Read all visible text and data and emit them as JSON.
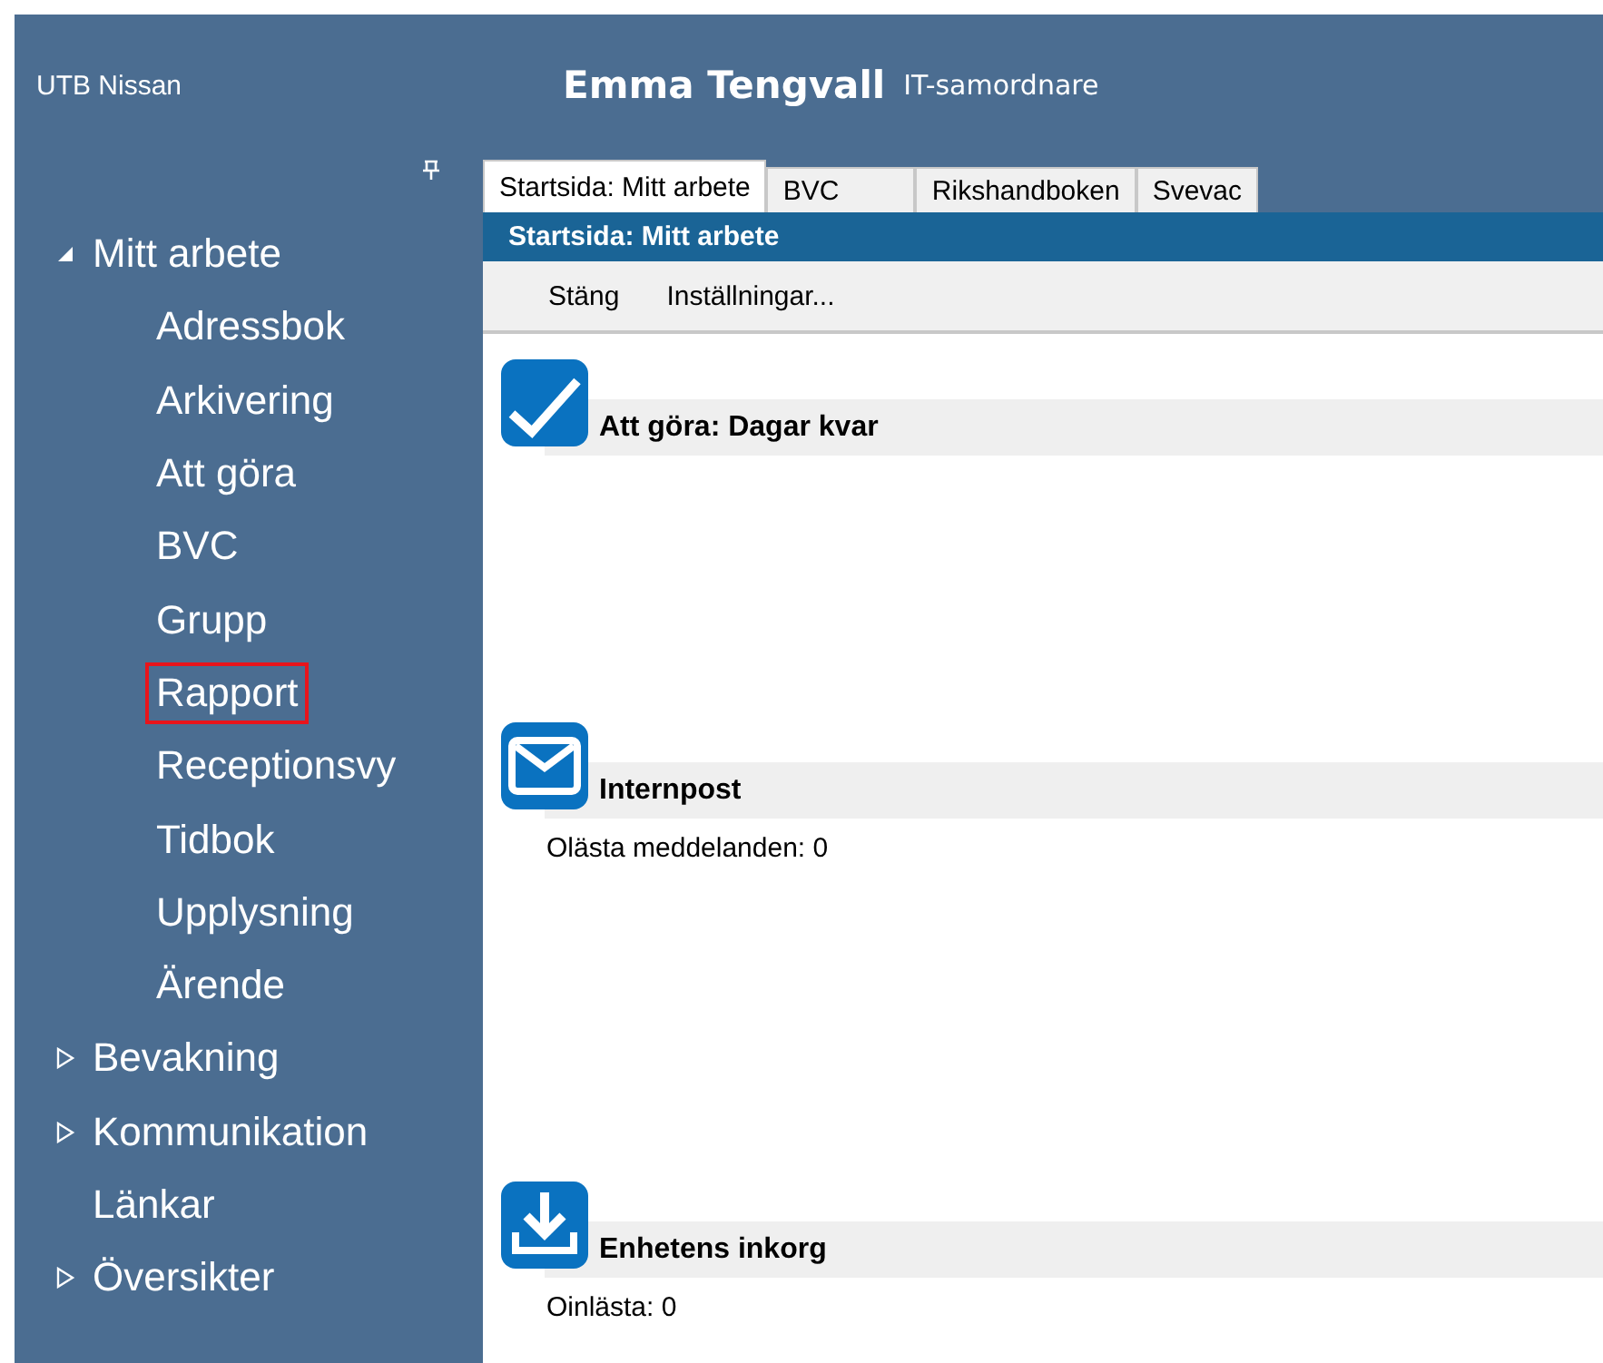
{
  "header": {
    "unit": "UTB Nissan",
    "user_name": "Emma Tengvall",
    "user_role": "IT-samordnare"
  },
  "sidebar": {
    "items": [
      {
        "label": "Mitt arbete",
        "expanded": true,
        "children": [
          {
            "label": "Adressbok",
            "marked": false
          },
          {
            "label": "Arkivering",
            "marked": false
          },
          {
            "label": "Att göra",
            "marked": false
          },
          {
            "label": "BVC",
            "marked": false
          },
          {
            "label": "Grupp",
            "marked": false
          },
          {
            "label": "Rapport",
            "marked": true
          },
          {
            "label": "Receptionsvy",
            "marked": false
          },
          {
            "label": "Tidbok",
            "marked": false
          },
          {
            "label": "Upplysning",
            "marked": false
          },
          {
            "label": "Ärende",
            "marked": false
          }
        ]
      },
      {
        "label": "Bevakning",
        "expanded": false
      },
      {
        "label": "Kommunikation",
        "expanded": false
      },
      {
        "label": "Länkar"
      },
      {
        "label": "Översikter",
        "expanded": false
      }
    ]
  },
  "tabs": [
    {
      "label": "Startsida: Mitt arbete",
      "selected": true
    },
    {
      "label": "BVC",
      "selected": false
    },
    {
      "label": "Rikshandboken",
      "selected": false
    },
    {
      "label": "Svevac",
      "selected": false
    }
  ],
  "panel": {
    "title": "Startsida: Mitt arbete",
    "toolbar": [
      "Stäng",
      "Inställningar..."
    ],
    "sections": [
      {
        "kind": "todo",
        "title": "Att göra: Dagar kvar"
      },
      {
        "kind": "mail",
        "title": "Internpost",
        "lines": [
          "Olästa meddelanden: 0"
        ]
      },
      {
        "kind": "inbox",
        "title": "Enhetens inkorg",
        "lines": [
          "Oinlästa: 0"
        ]
      }
    ]
  }
}
